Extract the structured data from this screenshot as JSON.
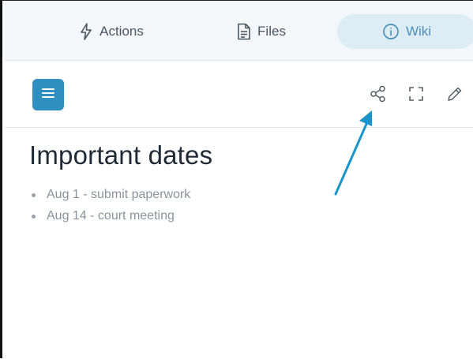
{
  "tabs": [
    {
      "label": "Actions",
      "icon": "lightning-icon",
      "active": false
    },
    {
      "label": "Files",
      "icon": "file-icon",
      "active": false
    },
    {
      "label": "Wiki",
      "icon": "info-icon",
      "active": true
    }
  ],
  "toolbar": {
    "menu_icon": "hamburger-menu-icon",
    "share_icon": "share-icon",
    "expand_icon": "fullscreen-icon",
    "edit_icon": "pencil-icon"
  },
  "wiki": {
    "title": "Important dates",
    "items": [
      "Aug 1 - submit paperwork",
      "Aug 14 - court meeting"
    ]
  },
  "colors": {
    "accent": "#2f8fc1",
    "active_tab_bg": "#dcedf6",
    "active_tab_text": "#4d8eb8",
    "arrow": "#1b95c9"
  }
}
